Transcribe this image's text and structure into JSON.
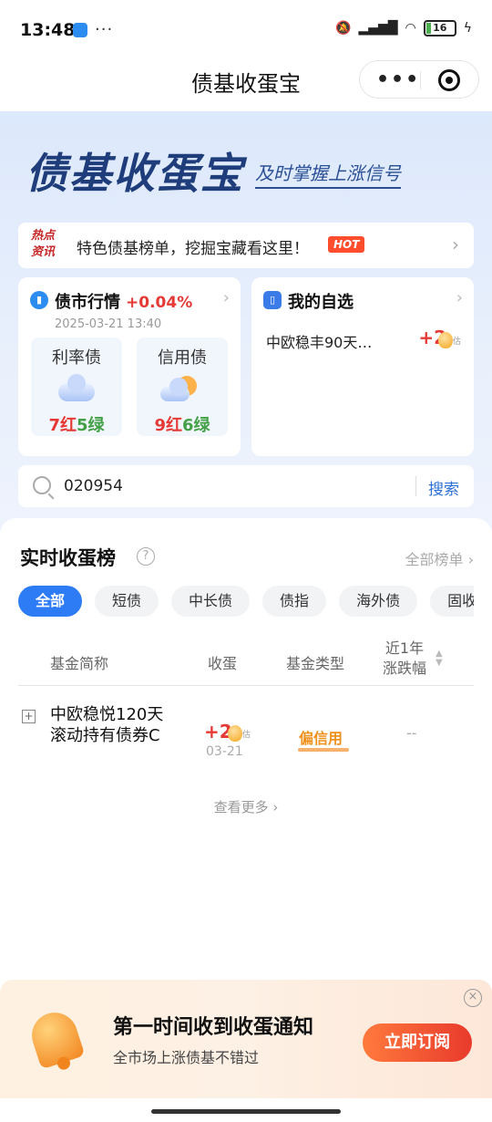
{
  "status": {
    "time": "13:48",
    "battery": "16"
  },
  "header": {
    "title": "债基收蛋宝"
  },
  "hero": {
    "logo": "债基收蛋宝",
    "slogan": "及时掌握上涨信号"
  },
  "news": {
    "tag_line1": "热点",
    "tag_line2": "资讯",
    "text": "特色债基榜单，挖掘宝藏看这里！",
    "badge": "HOT"
  },
  "market": {
    "title": "债市行情",
    "change": "+0.04%",
    "date": "2025-03-21 13:40",
    "rate": {
      "label": "利率债",
      "red": "7红",
      "green": "5绿"
    },
    "credit": {
      "label": "信用债",
      "red": "9红",
      "green": "6绿"
    }
  },
  "favorites": {
    "title": "我的自选",
    "item": "中欧稳丰90天…",
    "value": "+2",
    "est": "估"
  },
  "search": {
    "value": "020954",
    "button": "搜索"
  },
  "ranking": {
    "title": "实时收蛋榜",
    "all_link": "全部榜单",
    "tabs": [
      "全部",
      "短债",
      "中长债",
      "债指",
      "海外债",
      "固收+"
    ],
    "columns": {
      "name": "基金简称",
      "egg": "收蛋",
      "type": "基金类型",
      "change_line1": "近1年",
      "change_line2": "涨跌幅"
    },
    "rows": [
      {
        "name": "中欧稳悦120天滚动持有债券C",
        "egg": "+2",
        "est": "估",
        "date": "03-21",
        "type": "偏信用",
        "change": "--"
      }
    ],
    "view_more": "查看更多"
  },
  "subscription": {
    "title": "第一时间收到收蛋通知",
    "desc": "全市场上涨债基不错过",
    "button": "立即订阅"
  }
}
